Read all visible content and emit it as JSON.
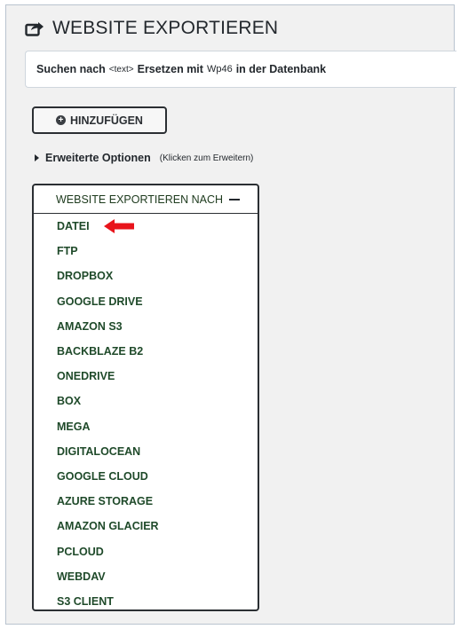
{
  "page": {
    "title": "WEBSITE EXPORTIEREN",
    "title_icon": "export-icon"
  },
  "search_replace": {
    "prefix": "Suchen nach",
    "placeholder_token": "<text>",
    "middle": "Ersetzen mit",
    "replace_token": "Wp46",
    "suffix": "in der Datenbank"
  },
  "add_button": {
    "label": "HINZUFÜGEN",
    "icon": "plus-circle-icon"
  },
  "advanced_options": {
    "label": "Erweiterte Optionen",
    "hint": "(Klicken zum Erweitern)"
  },
  "export_panel": {
    "header": "WEBSITE EXPORTIEREN NACH",
    "collapse_icon": "minus-icon",
    "items": [
      {
        "label": "DATEI",
        "highlighted": true
      },
      {
        "label": "FTP"
      },
      {
        "label": "DROPBOX"
      },
      {
        "label": "GOOGLE DRIVE"
      },
      {
        "label": "AMAZON S3"
      },
      {
        "label": "BACKBLAZE B2"
      },
      {
        "label": "ONEDRIVE"
      },
      {
        "label": "BOX"
      },
      {
        "label": "MEGA"
      },
      {
        "label": "DIGITALOCEAN"
      },
      {
        "label": "GOOGLE CLOUD"
      },
      {
        "label": "AZURE STORAGE"
      },
      {
        "label": "AMAZON GLACIER"
      },
      {
        "label": "PCLOUD"
      },
      {
        "label": "WEBDAV"
      },
      {
        "label": "S3 CLIENT"
      }
    ]
  },
  "colors": {
    "background": "#f1f1f1",
    "menu_text": "#1f4a2a",
    "annotation_arrow": "#e8141b",
    "border": "#2b2f33"
  }
}
